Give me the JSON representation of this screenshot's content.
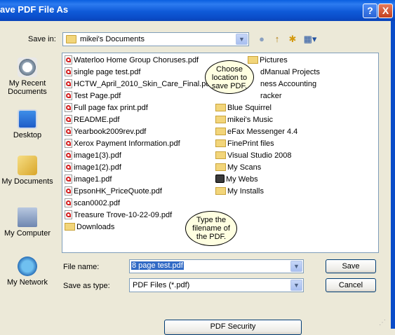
{
  "window": {
    "title": "ave PDF File As"
  },
  "title_buttons": {
    "help": "?",
    "close": "X"
  },
  "save_in": {
    "label": "Save in:",
    "value": "mikei's Documents",
    "dropdown_glyph": "▼"
  },
  "toolbar": {
    "back": "●",
    "up": "↑",
    "new_folder": "✱",
    "views": "▦▾"
  },
  "places": [
    {
      "label": "My Recent Documents",
      "icon": "recent-documents-icon"
    },
    {
      "label": "Desktop",
      "icon": "desktop-icon"
    },
    {
      "label": "My Documents",
      "icon": "my-documents-icon"
    },
    {
      "label": "My Computer",
      "icon": "my-computer-icon"
    },
    {
      "label": "My Network",
      "icon": "my-network-icon"
    }
  ],
  "files_left": [
    "Waterloo Home Group Choruses.pdf",
    "single page test.pdf",
    "HCTW_April_2010_Skin_Care_Final.pdf",
    "Test Page.pdf",
    "Full page fax print.pdf",
    "README.pdf",
    "Yearbook2009rev.pdf",
    "Xerox Payment Information.pdf",
    "image1(3).pdf",
    "image1(2).pdf",
    "image1.pdf",
    "EpsonHK_PriceQuote.pdf",
    "scan0002.pdf",
    "Treasure Trove-10-22-09.pdf",
    "Downloads"
  ],
  "files_right": [
    "Pictures",
    "dManual Projects",
    "ness Accounting",
    "racker",
    "Blue Squirrel",
    "mikei's Music",
    "eFax Messenger 4.4",
    "FinePrint files",
    "Visual Studio 2008",
    "My Scans",
    "My Webs",
    "My Installs"
  ],
  "balloons": {
    "location": "Choose location to save PDF.",
    "filename": "Type the filename of the PDF."
  },
  "file_name": {
    "label": "File name:",
    "value": "8 page test.pdf"
  },
  "save_as_type": {
    "label": "Save as type:",
    "value": "PDF Files (*.pdf)"
  },
  "buttons": {
    "save": "Save",
    "cancel": "Cancel",
    "pdf_security": "PDF Security"
  }
}
